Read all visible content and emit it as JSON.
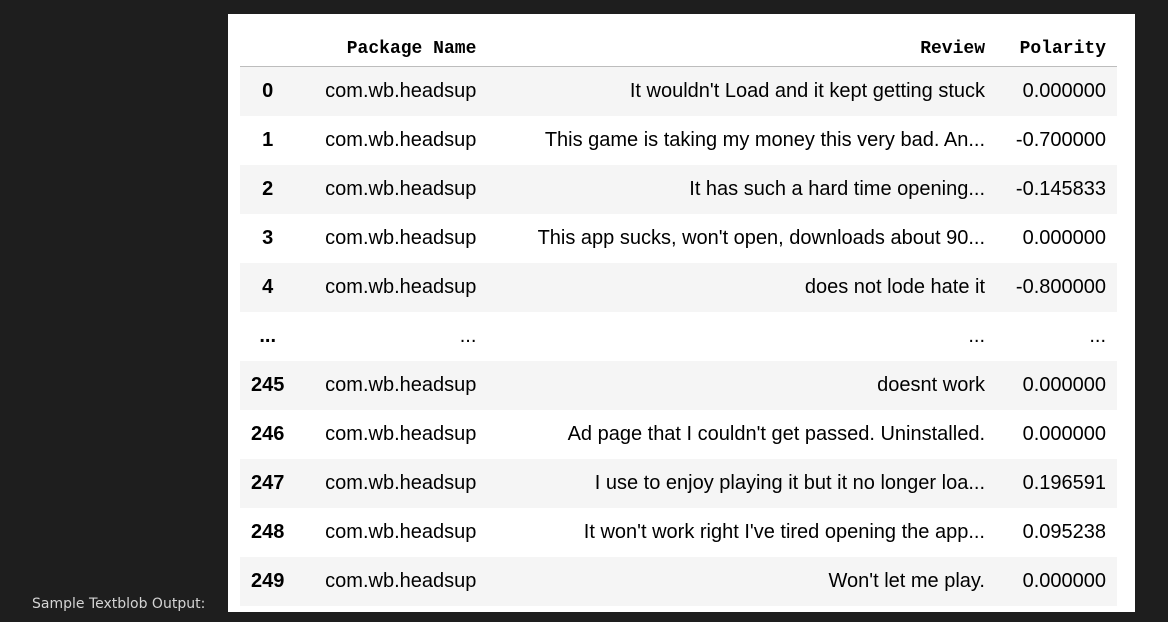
{
  "caption": "Sample Textblob Output:",
  "table": {
    "index_header": "",
    "columns": [
      "Package Name",
      "Review",
      "Polarity"
    ],
    "rows": [
      {
        "index": "0",
        "package": "com.wb.headsup",
        "review": "It wouldn't Load and it kept getting stuck",
        "polarity": "0.000000"
      },
      {
        "index": "1",
        "package": "com.wb.headsup",
        "review": "This game is taking my money this very bad. An...",
        "polarity": "-0.700000"
      },
      {
        "index": "2",
        "package": "com.wb.headsup",
        "review": "It has such a hard time opening...",
        "polarity": "-0.145833"
      },
      {
        "index": "3",
        "package": "com.wb.headsup",
        "review": "This app sucks, won't open, downloads about 90...",
        "polarity": "0.000000"
      },
      {
        "index": "4",
        "package": "com.wb.headsup",
        "review": "does not lode hate it",
        "polarity": "-0.800000"
      },
      {
        "index": "...",
        "package": "...",
        "review": "...",
        "polarity": "..."
      },
      {
        "index": "245",
        "package": "com.wb.headsup",
        "review": "doesnt work",
        "polarity": "0.000000"
      },
      {
        "index": "246",
        "package": "com.wb.headsup",
        "review": "Ad page that I couldn't get passed. Uninstalled.",
        "polarity": "0.000000"
      },
      {
        "index": "247",
        "package": "com.wb.headsup",
        "review": "I use to enjoy playing it but it no longer loa...",
        "polarity": "0.196591"
      },
      {
        "index": "248",
        "package": "com.wb.headsup",
        "review": "It won't work right I've tired opening the app...",
        "polarity": "0.095238"
      },
      {
        "index": "249",
        "package": "com.wb.headsup",
        "review": "Won't let me play.",
        "polarity": "0.000000"
      }
    ]
  },
  "colors": {
    "background": "#1e1e1e",
    "panel": "#ffffff",
    "row_stripe": "#f5f5f5",
    "caption_text": "#d4d4d4"
  }
}
